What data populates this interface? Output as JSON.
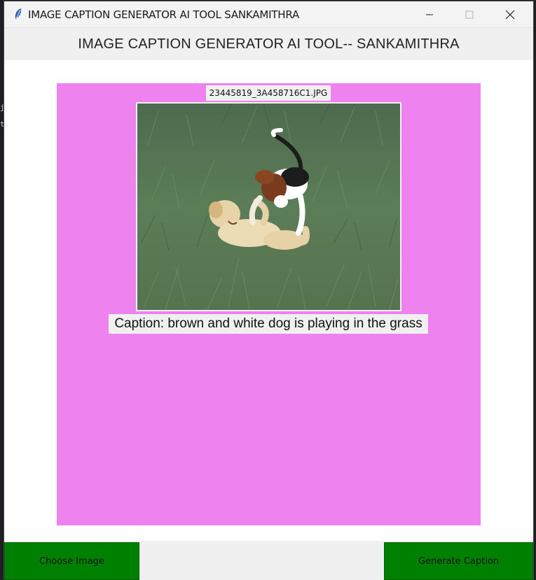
{
  "window": {
    "title": "IMAGE CAPTION GENERATOR AI TOOL SANKAMITHRA",
    "minimize_icon": "minimize-icon",
    "maximize_icon": "maximize-icon",
    "close_icon": "close-icon"
  },
  "header": {
    "heading": "IMAGE CAPTION GENERATOR AI TOOL-- SANKAMITHRA"
  },
  "panel": {
    "background_color": "#ee82ee",
    "filename": "23445819_3A458716C1.JPG",
    "image_description_icon": "dog-photo",
    "caption": "Caption: brown and white dog is playing in the grass"
  },
  "buttons": {
    "choose_image": "Choose Image",
    "generate_caption": "Generate Caption",
    "color": "#008000"
  }
}
